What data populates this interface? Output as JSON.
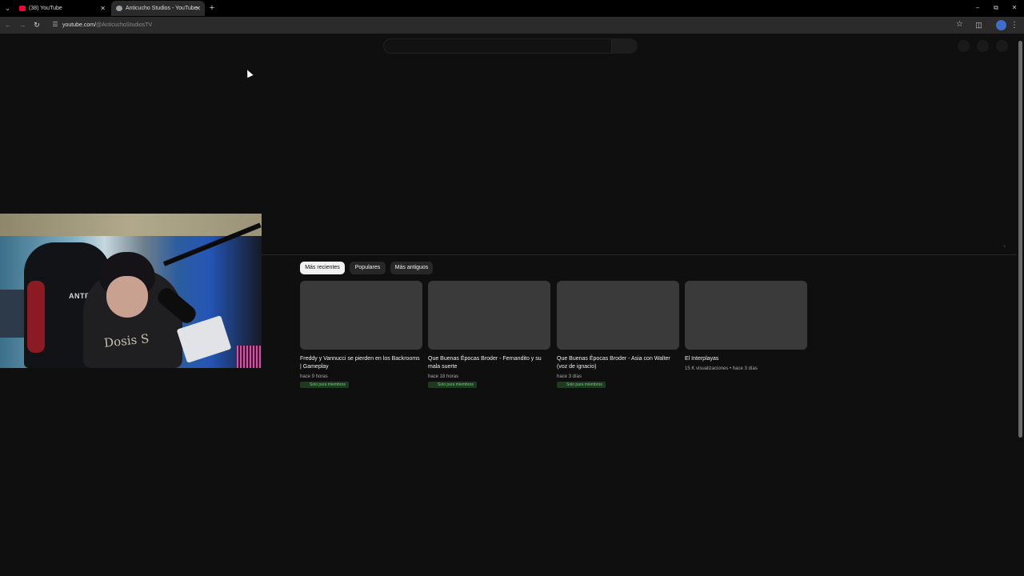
{
  "browser": {
    "tabs": [
      {
        "title": "(38) YouTube",
        "favicon": "youtube-icon",
        "active": false
      },
      {
        "title": "Anticucho Studios - YouTube",
        "favicon": "globe-icon",
        "active": true
      }
    ],
    "url_domain": "youtube.com/",
    "url_path": "@AnticuchoStudiosTV",
    "colors": {
      "chrome_dark": "#000000",
      "toolbar": "#2b2b2b",
      "page_bg": "#0f0f0f"
    }
  },
  "channel": {
    "filters": [
      {
        "label": "Más recientes",
        "selected": true
      },
      {
        "label": "Populares",
        "selected": false
      },
      {
        "label": "Más antiguos",
        "selected": false
      }
    ],
    "videos": [
      {
        "title": "Freddy y Vannucci se pierden en los Backrooms | Gameplay",
        "meta": "hace 9 horas",
        "badge": "Solo para miembros"
      },
      {
        "title": "Que Buenas Épocas Broder - Fernandito y su mala suerte",
        "meta": "hace 18 horas",
        "badge": "Solo para miembros"
      },
      {
        "title": "Que Buenas Épocas Broder - Asia con Walter (voz de ignacio)",
        "meta": "hace 3 días",
        "badge": "Solo para miembros"
      },
      {
        "title": "El Interplayas",
        "meta": "15 K visualizaciones • hace 3 días",
        "badge": ""
      }
    ]
  },
  "webcam": {
    "chair_brand": "ANTEX",
    "shirt_text": "Dosis S"
  }
}
